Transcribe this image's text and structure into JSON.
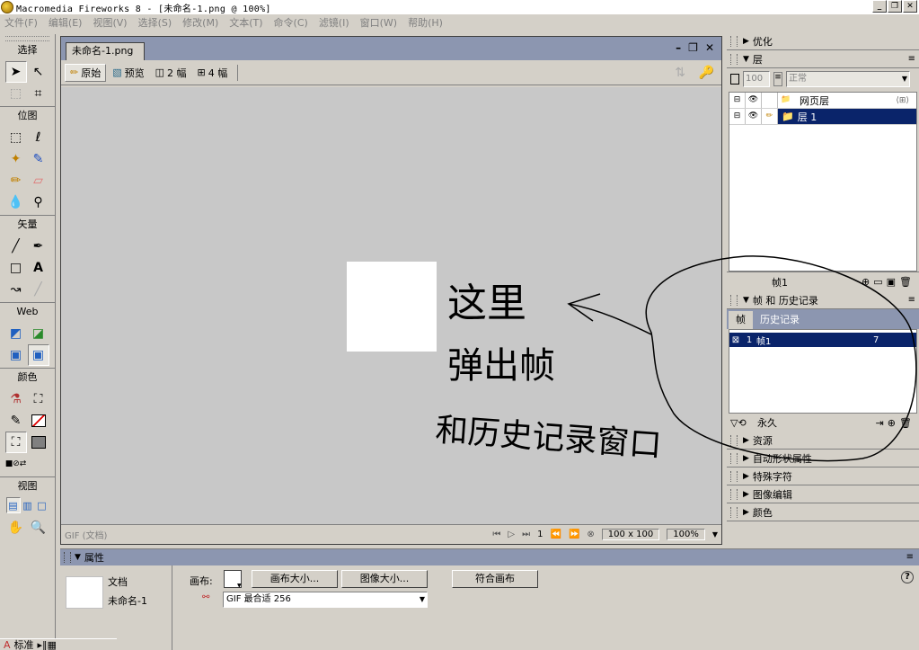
{
  "window": {
    "title": "Macromedia Fireworks 8 - [未命名-1.png @ 100%]"
  },
  "menu": [
    "文件(F)",
    "编辑(E)",
    "视图(V)",
    "选择(S)",
    "修改(M)",
    "文本(T)",
    "命令(C)",
    "滤镜(I)",
    "窗口(W)",
    "帮助(H)"
  ],
  "tools": {
    "select": "选择",
    "bitmap": "位图",
    "vector": "矢量",
    "web": "Web",
    "color": "颜色",
    "view": "视图"
  },
  "document": {
    "tab": "未命名-1.png",
    "views": [
      "原始",
      "预览",
      "2 幅",
      "4 幅"
    ],
    "status_left": "GIF (文档)",
    "frame": "1",
    "size": "100 x 100",
    "zoom": "100%"
  },
  "annotation": {
    "line1": "这里",
    "line2": "弹出帧",
    "line3": "和历史记录窗口"
  },
  "panels": {
    "optimize": "优化",
    "layers": "层",
    "opacity": "100",
    "blend": "正常",
    "web_layer": "网页层",
    "layer1": "层 1",
    "frame_name": "帧1",
    "frames_history": "帧 和 历史记录",
    "tab_frames": "帧",
    "tab_history": "历史记录",
    "frame_row_num": "1",
    "frame_row_name": "帧1",
    "frame_row_delay": "7",
    "loop": "永久",
    "assets": "资源",
    "auto_shape": "自动形状属性",
    "special_chars": "特殊字符",
    "image_edit": "图像编辑",
    "colors": "颜色"
  },
  "properties": {
    "title": "属性",
    "doc_label": "文档",
    "doc_name": "未命名-1",
    "canvas_label": "画布:",
    "canvas_size": "画布大小...",
    "image_size": "图像大小...",
    "fit_canvas": "符合画布",
    "optimize_preset": "GIF 最合适 256",
    "help": "?"
  },
  "taskbar": {
    "label": "标准"
  }
}
